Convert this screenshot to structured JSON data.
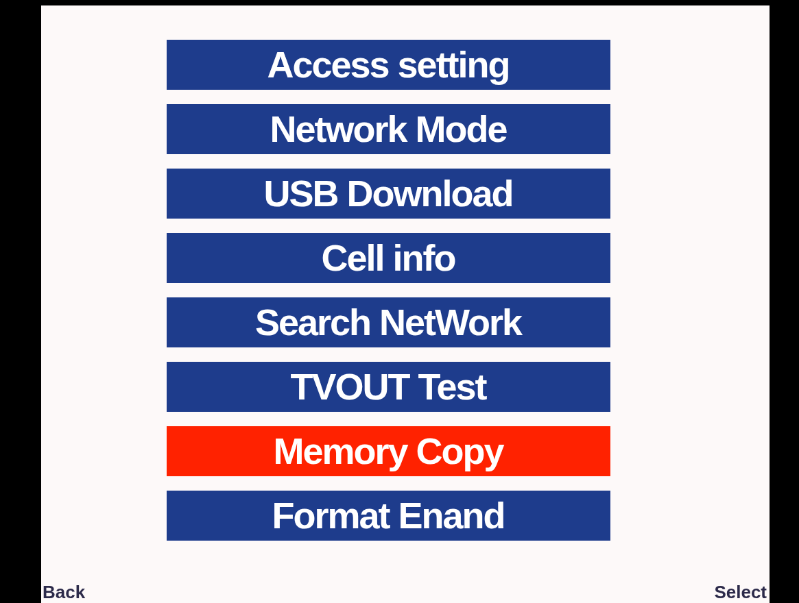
{
  "menu": [
    {
      "label": "Access setting",
      "selected": false
    },
    {
      "label": "Network Mode",
      "selected": false
    },
    {
      "label": "USB Download",
      "selected": false
    },
    {
      "label": "Cell info",
      "selected": false
    },
    {
      "label": "Search NetWork",
      "selected": false
    },
    {
      "label": "TVOUT Test",
      "selected": false
    },
    {
      "label": "Memory Copy",
      "selected": true
    },
    {
      "label": "Format Enand",
      "selected": false
    }
  ],
  "softkeys": {
    "left": "Back",
    "right": "Select"
  }
}
